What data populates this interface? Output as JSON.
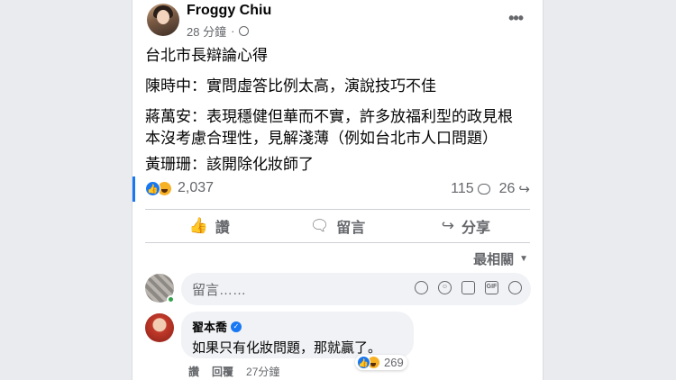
{
  "post": {
    "author": "Froggy Chiu",
    "time": "28 分鐘",
    "lines": [
      "台北市長辯論心得",
      "陳時中：實問虛答比例太高，演說技巧不佳",
      "蔣萬安：表現穩健但華而不實，許多放福利型的政見根",
      "本沒考慮合理性，見解淺薄（例如台北市人口問題）",
      "黃珊珊：該開除化妝師了"
    ]
  },
  "stats": {
    "reactions": "2,037",
    "comments": "115",
    "shares": "26"
  },
  "actions": {
    "like": "讚",
    "comment": "留言",
    "share": "分享"
  },
  "sort_label": "最相關",
  "comment_input": {
    "placeholder": "留言……"
  },
  "comment": {
    "author": "翟本喬",
    "text": "如果只有化妝問題，那就贏了。",
    "reactions": "269",
    "like": "讚",
    "reply": "回覆",
    "time": "27分鐘"
  },
  "colors": {
    "brand": "#1877f2",
    "text_secondary": "#65676b",
    "haha": "#f7b125"
  }
}
